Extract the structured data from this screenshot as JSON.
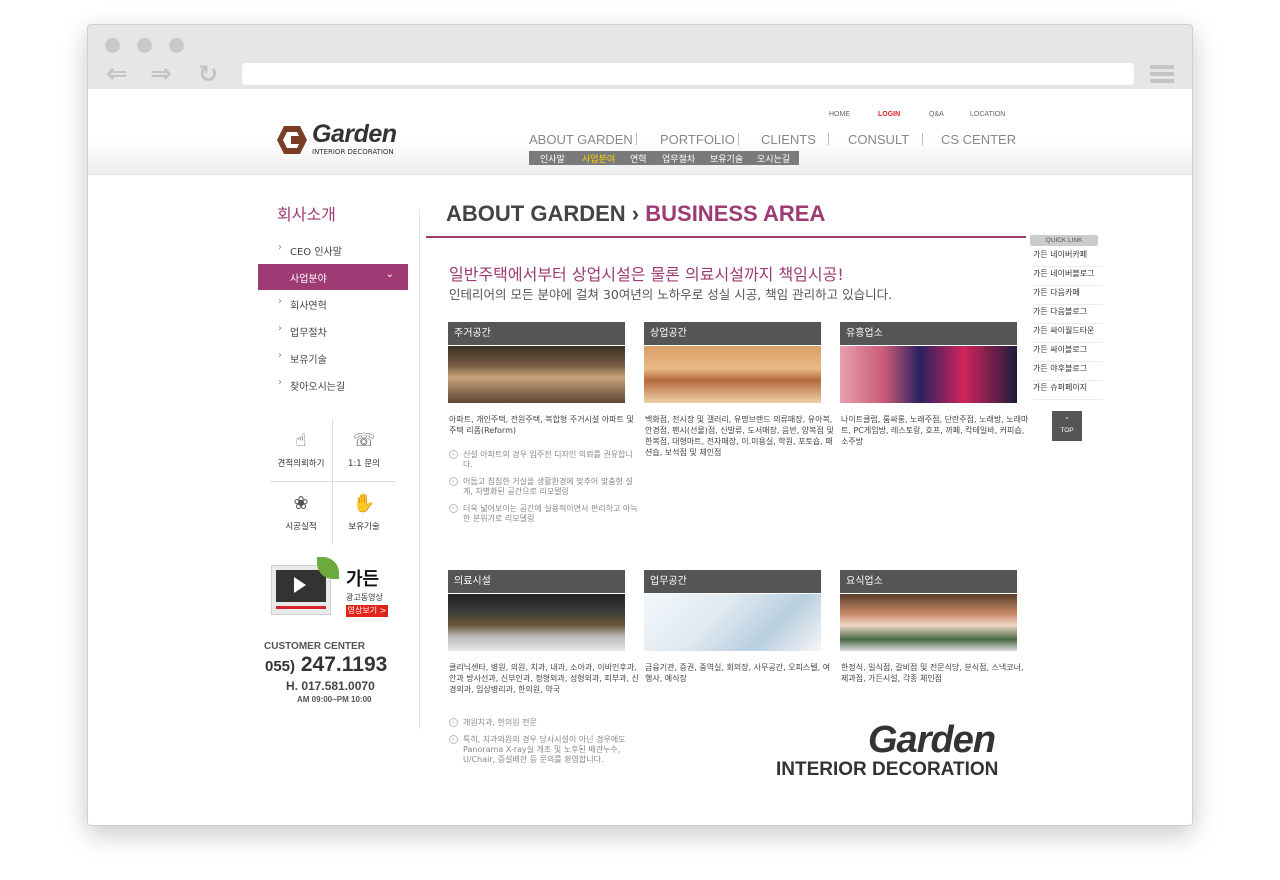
{
  "header": {
    "logo_text": "Garden",
    "logo_sub": "INTERIOR DECORATION",
    "util": [
      "HOME",
      "LOGIN",
      "Q&A",
      "LOCATION"
    ],
    "gnb": [
      "ABOUT GARDEN",
      "PORTFOLIO",
      "CLIENTS",
      "CONSULT",
      "CS CENTER"
    ],
    "subnav": [
      "인사말",
      "사업분야",
      "연혁",
      "업무절차",
      "보유기술",
      "오시는길"
    ]
  },
  "lnb": {
    "title": "회사소개",
    "items": [
      "CEO 인사말",
      "사업분야",
      "회사연혁",
      "업무절차",
      "보유기술",
      "찾아오시는길"
    ]
  },
  "quick": {
    "cells": [
      "견적의뢰하기",
      "1:1 문의",
      "시공실적",
      "보유기술"
    ]
  },
  "ad": {
    "brand": "가든",
    "label": "광고동영상",
    "button": "영상보기 >"
  },
  "customer_center": {
    "title": "CUSTOMER CENTER",
    "area": "055)",
    "phone": "247.1193",
    "mobile": "H. 017.581.0070",
    "hours": "AM 09:00~PM 10:00"
  },
  "main": {
    "crumb1": "ABOUT GARDEN",
    "crumb_sep": "›",
    "crumb2": "BUSINESS AREA",
    "headline": "일반주택에서부터 상업시설은 물론 의료시설까지 책임시공!",
    "subline": "인테리어의 모든 분야에 걸쳐 30여년의 노하우로 성실 시공, 책임 관리하고 있습니다."
  },
  "cards": [
    {
      "title": "주거공간",
      "desc": "아파트, 개인주택, 전원주택, 복합형 주거시설 아파트 및 주택 리폼(Reform)",
      "bullets": [
        "신설 아파트의 경우 입주전 디자인 의뢰를 권유합니다.",
        "어둡고 침침한 거실을 생활환경에 맞추어 맞춤형 설계, 차별화된 공간으로 리모델링",
        "더욱 넓어보이는 공간에 실용적이면서 편리하고 아늑한 분위기로 리모델링"
      ]
    },
    {
      "title": "상업공간",
      "desc": "백화점, 전시장 및 갤러리, 유명브랜드 의류매장, 유아복, 안경점, 팬시(선물)점, 신발류, 도서매장, 음반, 양복점 및 한복점, 대형마트, 전자매장, 이.미용실, 학원, 포토숍, 패션숍, 보석점 및 체인점",
      "bullets": []
    },
    {
      "title": "유흥업소",
      "desc": "나이트클럽, 룸싸롱, 노래주점, 단란주점, 노래방, 노래마트, PC게임방, 레스토랑, 호프, 까페, 칵테일바, 커피숍, 소주방",
      "bullets": []
    },
    {
      "title": "의료시설",
      "desc": "클리닉센타, 병원, 의원, 치과, 내과, 소아과, 이비인후과, 안과 방사선과, 신부인과, 정형외과, 성형외과, 피부과, 신경외과, 임상병리과, 한의원, 약국",
      "bullets": [
        "개원치과, 한의원 전문",
        "특히, 치과의원의 경우 당사시설이 아닌 경우에도 Panorama X-ray실 개조 및 노후된 배관누수, U/Chair, 증설배관 등 문의를 환영합니다."
      ]
    },
    {
      "title": "업무공간",
      "desc": "금융기관, 증권, 중역실, 회의장, 사무공간, 오피스텔, 여행사, 예식장",
      "bullets": []
    },
    {
      "title": "요식업소",
      "desc": "한정식, 일식점, 갈비점 및 전문식당, 분식점, 스낵코너, 제과점, 가든시설, 각종 체인점",
      "bullets": []
    }
  ],
  "signature": {
    "logo": "Garden",
    "sub": "INTERIOR DECORATION"
  },
  "quicklink": {
    "title": "QUICK LINK",
    "items": [
      "가든 네이버카페",
      "가든 네이버블로그",
      "가든 다음카페",
      "가든 다음블로그",
      "가든 싸이월드타운",
      "가든 싸이블로그",
      "가든 야후블로그",
      "가든 슈퍼페이지"
    ],
    "top": "TOP"
  },
  "colors": {
    "accent": "#9e3a74",
    "card_header": "#555555",
    "login": "#d8232a"
  }
}
